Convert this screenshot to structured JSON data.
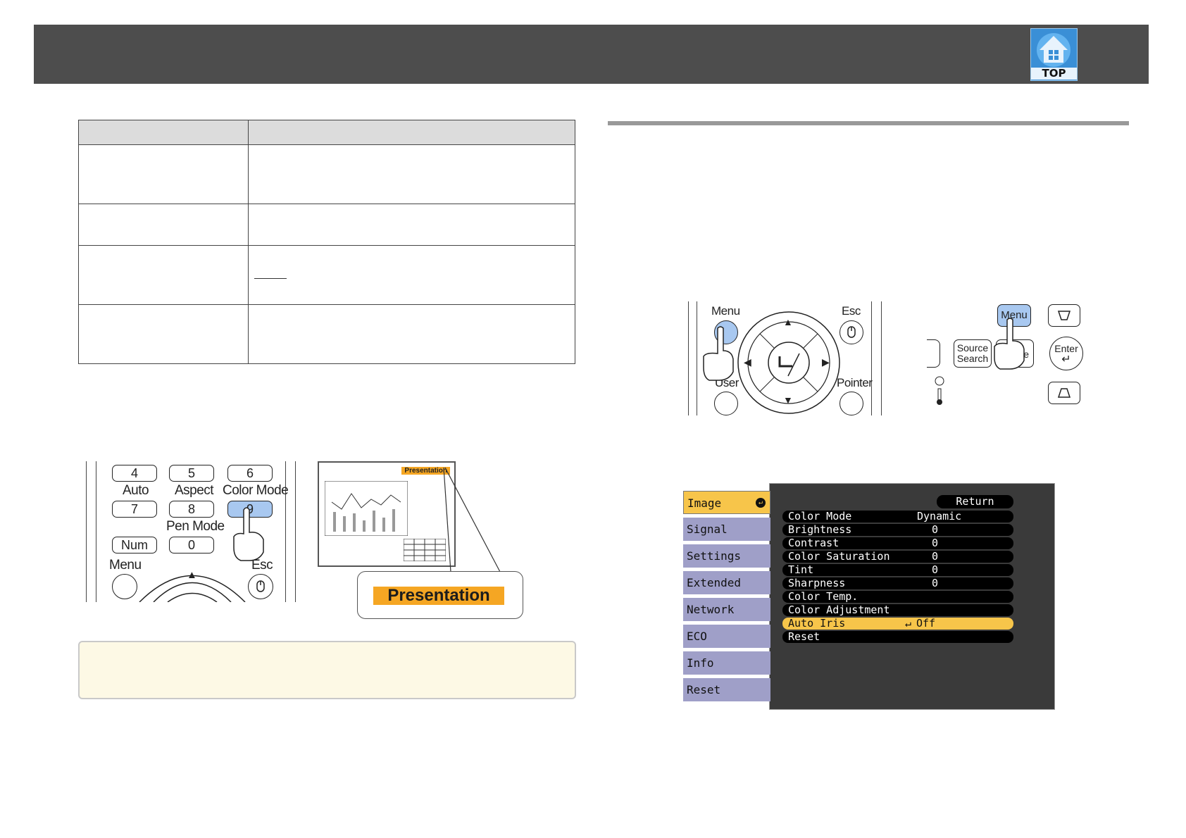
{
  "header": {
    "top_button_label": "TOP",
    "color": "#4d4d4d"
  },
  "remote_left": {
    "keys": [
      {
        "label": "4"
      },
      {
        "label": "5"
      },
      {
        "label": "6"
      },
      {
        "label": "7"
      },
      {
        "label": "8"
      },
      {
        "label": "9"
      },
      {
        "label": "Num"
      },
      {
        "label": "0"
      }
    ],
    "labels": {
      "auto": "Auto",
      "aspect": "Aspect",
      "color_mode": "Color Mode",
      "pen_mode": "Pen Mode",
      "menu": "Menu",
      "esc": "Esc"
    },
    "up_arrow": "▲",
    "highlight_color": "#a8c8f0"
  },
  "preview": {
    "screen_label": "Presentation",
    "callout_label": "Presentation",
    "label_color": "#f5a623"
  },
  "remote_right": {
    "labels": {
      "menu": "Menu",
      "esc": "Esc",
      "user": "User",
      "pointer": "Pointer"
    },
    "arrows": {
      "up": "▲",
      "down": "▼",
      "left": "◀",
      "right": "▶"
    }
  },
  "control_panel": {
    "labels": {
      "menu": "Menu",
      "source_search_1": "Source",
      "source_search_2": "Search",
      "enter": "Enter",
      "mode_fragment": "de"
    }
  },
  "osd": {
    "tabs": [
      {
        "label": "Image",
        "active": true
      },
      {
        "label": "Signal"
      },
      {
        "label": "Settings"
      },
      {
        "label": "Extended"
      },
      {
        "label": "Network"
      },
      {
        "label": "ECO"
      },
      {
        "label": "Info"
      },
      {
        "label": "Reset"
      }
    ],
    "return_label": "Return",
    "rows": [
      {
        "name": "Color Mode",
        "value": "Dynamic"
      },
      {
        "name": "Brightness",
        "value": "0"
      },
      {
        "name": "Contrast",
        "value": "0"
      },
      {
        "name": "Color Saturation",
        "value": "0"
      },
      {
        "name": "Tint",
        "value": "0"
      },
      {
        "name": "Sharpness",
        "value": "0"
      },
      {
        "name": "Color Temp.",
        "value": ""
      },
      {
        "name": "Color Adjustment",
        "value": ""
      },
      {
        "name": "Auto Iris",
        "value": "Off",
        "selected": true
      },
      {
        "name": "Reset",
        "value": ""
      }
    ],
    "highlight_color": "#f7c54a",
    "tab_color": "#9f9fc8"
  }
}
